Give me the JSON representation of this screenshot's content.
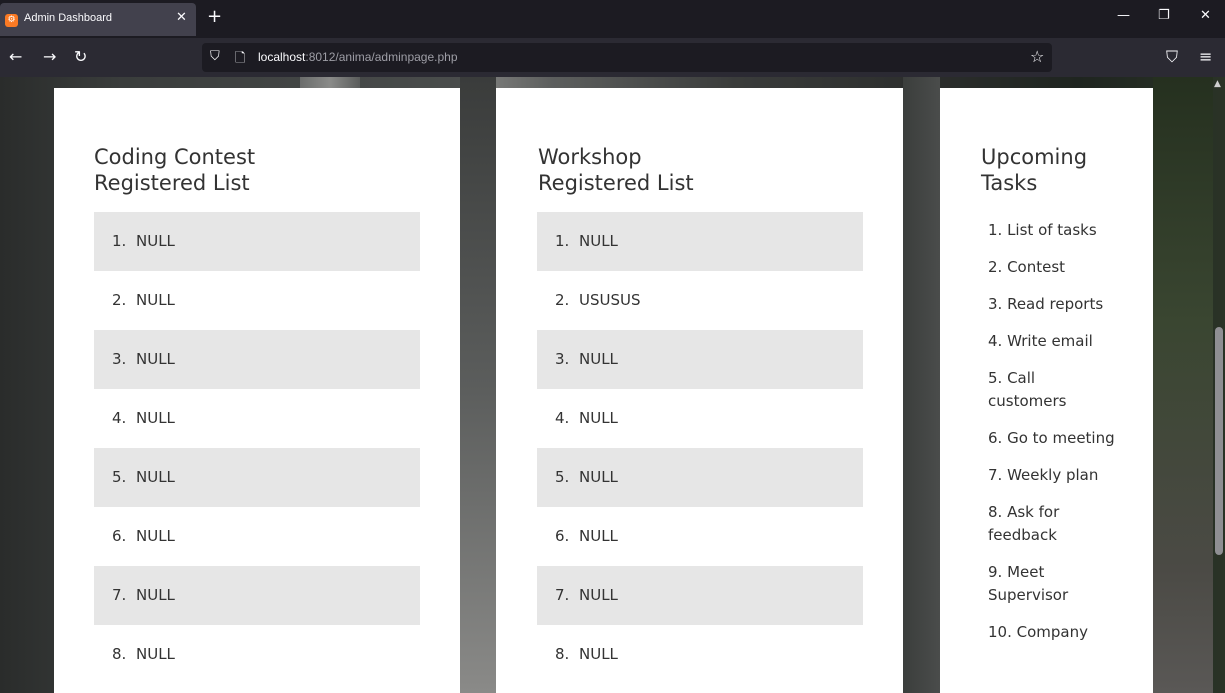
{
  "browser": {
    "tab_title": "Admin Dashboard",
    "favicon_label": "⚙",
    "url_host": "localhost",
    "url_rest": ":8012/anima/adminpage.php"
  },
  "icons": {
    "close": "✕",
    "new_tab": "+",
    "minimize": "—",
    "restore": "❐",
    "window_close": "✕",
    "back": "←",
    "forward": "→",
    "reload": "↻",
    "shield": "⛉",
    "page": "🗋",
    "star": "☆",
    "pocket": "⛉",
    "menu": "≡",
    "scroll_up": "▲"
  },
  "coding_contest": {
    "title_line1": "Coding Contest",
    "title_line2": "Registered List",
    "items": [
      {
        "num": "1.",
        "text": "NULL"
      },
      {
        "num": "2.",
        "text": "NULL"
      },
      {
        "num": "3.",
        "text": "NULL"
      },
      {
        "num": "4.",
        "text": "NULL"
      },
      {
        "num": "5.",
        "text": "NULL"
      },
      {
        "num": "6.",
        "text": "NULL"
      },
      {
        "num": "7.",
        "text": "NULL"
      },
      {
        "num": "8.",
        "text": "NULL"
      }
    ]
  },
  "workshop": {
    "title_line1": "Workshop",
    "title_line2": "Registered List",
    "items": [
      {
        "num": "1.",
        "text": "NULL"
      },
      {
        "num": "2.",
        "text": "USUSUS"
      },
      {
        "num": "3.",
        "text": "NULL"
      },
      {
        "num": "4.",
        "text": "NULL"
      },
      {
        "num": "5.",
        "text": "NULL"
      },
      {
        "num": "6.",
        "text": "NULL"
      },
      {
        "num": "7.",
        "text": "NULL"
      },
      {
        "num": "8.",
        "text": "NULL"
      }
    ]
  },
  "tasks": {
    "title_line1": "Upcoming",
    "title_line2": "Tasks",
    "items": [
      "1.  List of tasks",
      "2.  Contest",
      "3.  Read reports",
      "4.  Write email",
      "5.  Call customers",
      "6.  Go to meeting",
      "7.  Weekly plan",
      "8.  Ask for feedback",
      "9.  Meet Supervisor",
      "10.  Company"
    ]
  }
}
